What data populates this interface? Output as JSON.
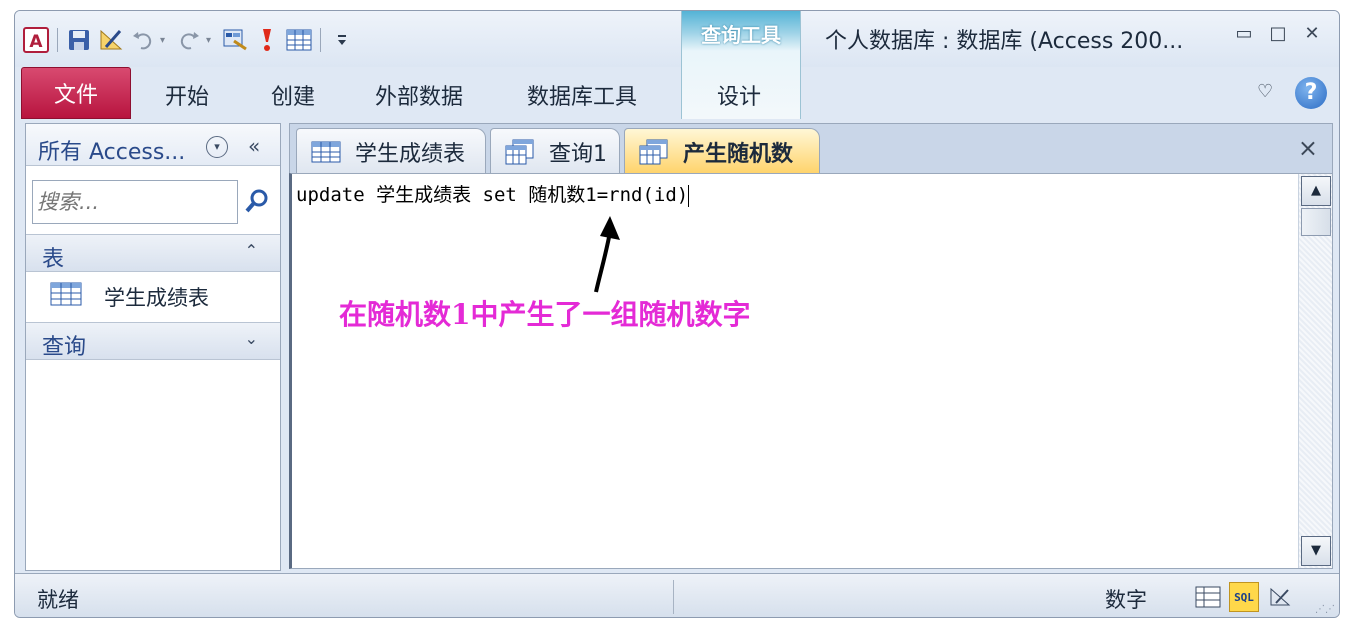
{
  "window": {
    "title": "个人数据库 : 数据库 (Access 200...",
    "minimize_glyph": "▭",
    "maximize_glyph": "□",
    "close_glyph": "✕"
  },
  "qat": {
    "icons": [
      "access-logo-icon",
      "save-icon",
      "design-icon",
      "undo-icon",
      "redo-icon",
      "view-icon",
      "run-icon",
      "table-icon",
      "customize-qat-icon"
    ]
  },
  "ribbon": {
    "context_group": "查询工具",
    "file_tab": "文件",
    "tabs": [
      "开始",
      "创建",
      "外部数据",
      "数据库工具"
    ],
    "context_tab": "设计",
    "help": "?",
    "minimize_glyph": "♡"
  },
  "nav": {
    "title": "所有 Access...",
    "dropdown_glyph": "▾",
    "collapse_glyph": "«",
    "search_placeholder": "搜索...",
    "groups": [
      {
        "label": "表",
        "chevron": "⌃",
        "items": [
          "学生成绩表"
        ]
      },
      {
        "label": "查询",
        "chevron": "⌄",
        "items": []
      }
    ]
  },
  "doc_tabs": {
    "tabs": [
      "学生成绩表",
      "查询1",
      "产生随机数"
    ],
    "active_index": 2,
    "close_glyph": "×"
  },
  "editor": {
    "sql": "update 学生成绩表 set 随机数1=rnd(id)",
    "annotation": "在随机数1中产生了一组随机数字",
    "scroll_up": "▲",
    "scroll_down": "▼"
  },
  "status": {
    "left": "就绪",
    "mode": "数字",
    "sql_view": "SQL"
  },
  "colors": {
    "file_tab": "#c41a47",
    "annotation": "#e42ad6",
    "active_tab": "#ffd36a",
    "context_tab": "#54b3d6"
  }
}
